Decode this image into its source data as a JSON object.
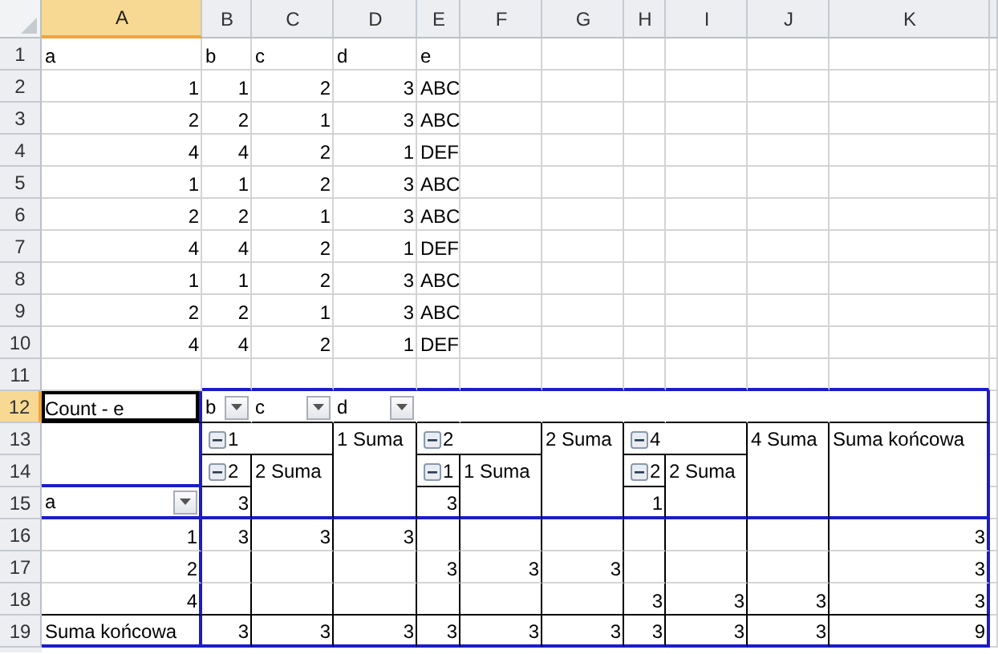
{
  "sheet": {
    "columns": [
      {
        "label": "A",
        "selected": true
      },
      {
        "label": "B",
        "selected": false
      },
      {
        "label": "C",
        "selected": false
      },
      {
        "label": "D",
        "selected": false
      },
      {
        "label": "E",
        "selected": false
      },
      {
        "label": "F",
        "selected": false
      },
      {
        "label": "G",
        "selected": false
      },
      {
        "label": "H",
        "selected": false
      },
      {
        "label": "I",
        "selected": false
      },
      {
        "label": "J",
        "selected": false
      },
      {
        "label": "K",
        "selected": false
      }
    ],
    "rows": [
      {
        "number": "1",
        "selected": false,
        "cells": [
          {
            "text": "a",
            "kind": "text"
          },
          {
            "text": "b",
            "kind": "text"
          },
          {
            "text": "c",
            "kind": "text"
          },
          {
            "text": "d",
            "kind": "text"
          },
          {
            "text": "e",
            "kind": "text"
          }
        ]
      },
      {
        "number": "2",
        "selected": false,
        "cells": [
          {
            "text": "1",
            "kind": "number"
          },
          {
            "text": "1",
            "kind": "number"
          },
          {
            "text": "2",
            "kind": "number"
          },
          {
            "text": "3",
            "kind": "number"
          },
          {
            "text": "ABC",
            "kind": "text"
          }
        ]
      },
      {
        "number": "3",
        "selected": false,
        "cells": [
          {
            "text": "2",
            "kind": "number"
          },
          {
            "text": "2",
            "kind": "number"
          },
          {
            "text": "1",
            "kind": "number"
          },
          {
            "text": "3",
            "kind": "number"
          },
          {
            "text": "ABC",
            "kind": "text"
          }
        ]
      },
      {
        "number": "4",
        "selected": false,
        "cells": [
          {
            "text": "4",
            "kind": "number"
          },
          {
            "text": "4",
            "kind": "number"
          },
          {
            "text": "2",
            "kind": "number"
          },
          {
            "text": "1",
            "kind": "number"
          },
          {
            "text": "DEF",
            "kind": "text"
          }
        ]
      },
      {
        "number": "5",
        "selected": false,
        "cells": [
          {
            "text": "1",
            "kind": "number"
          },
          {
            "text": "1",
            "kind": "number"
          },
          {
            "text": "2",
            "kind": "number"
          },
          {
            "text": "3",
            "kind": "number"
          },
          {
            "text": "ABC",
            "kind": "text"
          }
        ]
      },
      {
        "number": "6",
        "selected": false,
        "cells": [
          {
            "text": "2",
            "kind": "number"
          },
          {
            "text": "2",
            "kind": "number"
          },
          {
            "text": "1",
            "kind": "number"
          },
          {
            "text": "3",
            "kind": "number"
          },
          {
            "text": "ABC",
            "kind": "text"
          }
        ]
      },
      {
        "number": "7",
        "selected": false,
        "cells": [
          {
            "text": "4",
            "kind": "number"
          },
          {
            "text": "4",
            "kind": "number"
          },
          {
            "text": "2",
            "kind": "number"
          },
          {
            "text": "1",
            "kind": "number"
          },
          {
            "text": "DEF",
            "kind": "text"
          }
        ]
      },
      {
        "number": "8",
        "selected": false,
        "cells": [
          {
            "text": "1",
            "kind": "number"
          },
          {
            "text": "1",
            "kind": "number"
          },
          {
            "text": "2",
            "kind": "number"
          },
          {
            "text": "3",
            "kind": "number"
          },
          {
            "text": "ABC",
            "kind": "text"
          }
        ]
      },
      {
        "number": "9",
        "selected": false,
        "cells": [
          {
            "text": "2",
            "kind": "number"
          },
          {
            "text": "2",
            "kind": "number"
          },
          {
            "text": "1",
            "kind": "number"
          },
          {
            "text": "3",
            "kind": "number"
          },
          {
            "text": "ABC",
            "kind": "text"
          }
        ]
      },
      {
        "number": "10",
        "selected": false,
        "cells": [
          {
            "text": "4",
            "kind": "number"
          },
          {
            "text": "4",
            "kind": "number"
          },
          {
            "text": "2",
            "kind": "number"
          },
          {
            "text": "1",
            "kind": "number"
          },
          {
            "text": "DEF",
            "kind": "text"
          }
        ]
      },
      {
        "number": "11",
        "selected": false
      },
      {
        "number": "12",
        "selected": true,
        "kind": "filter",
        "cells": [
          {
            "text": "Count - e",
            "kind": "text",
            "selected": true
          },
          {
            "text": "b",
            "kind": "text",
            "dropdown": true
          },
          {
            "text": "c",
            "kind": "text",
            "dropdown": true
          },
          {
            "text": "d",
            "kind": "text",
            "dropdown": true
          }
        ]
      },
      {
        "number": "13",
        "selected": false,
        "kind": "column-header",
        "cells": [
          {
            "rowspan": 2
          },
          {
            "text": "1",
            "kind": "text",
            "collapse": true,
            "colspan": 2
          },
          {
            "text": "1 Suma",
            "kind": "text",
            "rowspan": 3
          },
          {
            "text": "2",
            "kind": "text",
            "collapse": true,
            "colspan": 2
          },
          {
            "text": "2 Suma",
            "kind": "text",
            "rowspan": 3
          },
          {
            "text": "4",
            "kind": "text",
            "collapse": true,
            "colspan": 2
          },
          {
            "text": "4 Suma",
            "kind": "text",
            "rowspan": 3
          },
          {
            "text": "Suma końcowa",
            "kind": "text",
            "rowspan": 3
          }
        ]
      },
      {
        "number": "14",
        "selected": false,
        "kind": "column-header",
        "cells": [
          {
            "text": "2",
            "kind": "text",
            "collapse": true
          },
          {
            "text": "2 Suma",
            "kind": "text",
            "rowspan": 2
          },
          {
            "text": "1",
            "kind": "text",
            "collapse": true
          },
          {
            "text": "1 Suma",
            "kind": "text",
            "rowspan": 2
          },
          {
            "text": "2",
            "kind": "text",
            "collapse": true
          },
          {
            "text": "2 Suma",
            "kind": "text",
            "rowspan": 2
          }
        ]
      },
      {
        "number": "15",
        "selected": false,
        "kind": "column-header",
        "cells": [
          {
            "text": "a",
            "kind": "text",
            "dropdown": true
          },
          {
            "text": "3",
            "kind": "number"
          },
          {
            "text": "3",
            "kind": "number"
          },
          {
            "text": "1",
            "kind": "number"
          }
        ]
      },
      {
        "number": "16",
        "selected": false,
        "kind": "body",
        "cells": [
          {
            "text": "1",
            "kind": "number"
          },
          {
            "text": "3",
            "kind": "number"
          },
          {
            "text": "3",
            "kind": "number"
          },
          {
            "text": "3",
            "kind": "number"
          },
          null,
          null,
          null,
          null,
          null,
          null,
          {
            "text": "3",
            "kind": "number"
          }
        ]
      },
      {
        "number": "17",
        "selected": false,
        "kind": "body",
        "cells": [
          {
            "text": "2",
            "kind": "number"
          },
          null,
          null,
          null,
          {
            "text": "3",
            "kind": "number"
          },
          {
            "text": "3",
            "kind": "number"
          },
          {
            "text": "3",
            "kind": "number"
          },
          null,
          null,
          null,
          {
            "text": "3",
            "kind": "number"
          }
        ]
      },
      {
        "number": "18",
        "selected": false,
        "kind": "body",
        "cells": [
          {
            "text": "4",
            "kind": "number"
          },
          null,
          null,
          null,
          null,
          null,
          null,
          {
            "text": "3",
            "kind": "number"
          },
          {
            "text": "3",
            "kind": "number"
          },
          {
            "text": "3",
            "kind": "number"
          },
          {
            "text": "3",
            "kind": "number"
          }
        ]
      },
      {
        "number": "19",
        "selected": false,
        "kind": "total",
        "cells": [
          {
            "text": "Suma końcowa",
            "kind": "text"
          },
          {
            "text": "3",
            "kind": "number"
          },
          {
            "text": "3",
            "kind": "number"
          },
          {
            "text": "3",
            "kind": "number"
          },
          {
            "text": "3",
            "kind": "number"
          },
          {
            "text": "3",
            "kind": "number"
          },
          {
            "text": "3",
            "kind": "number"
          },
          {
            "text": "3",
            "kind": "number"
          },
          {
            "text": "3",
            "kind": "number"
          },
          {
            "text": "3",
            "kind": "number"
          },
          {
            "text": "9",
            "kind": "number"
          }
        ]
      }
    ]
  }
}
